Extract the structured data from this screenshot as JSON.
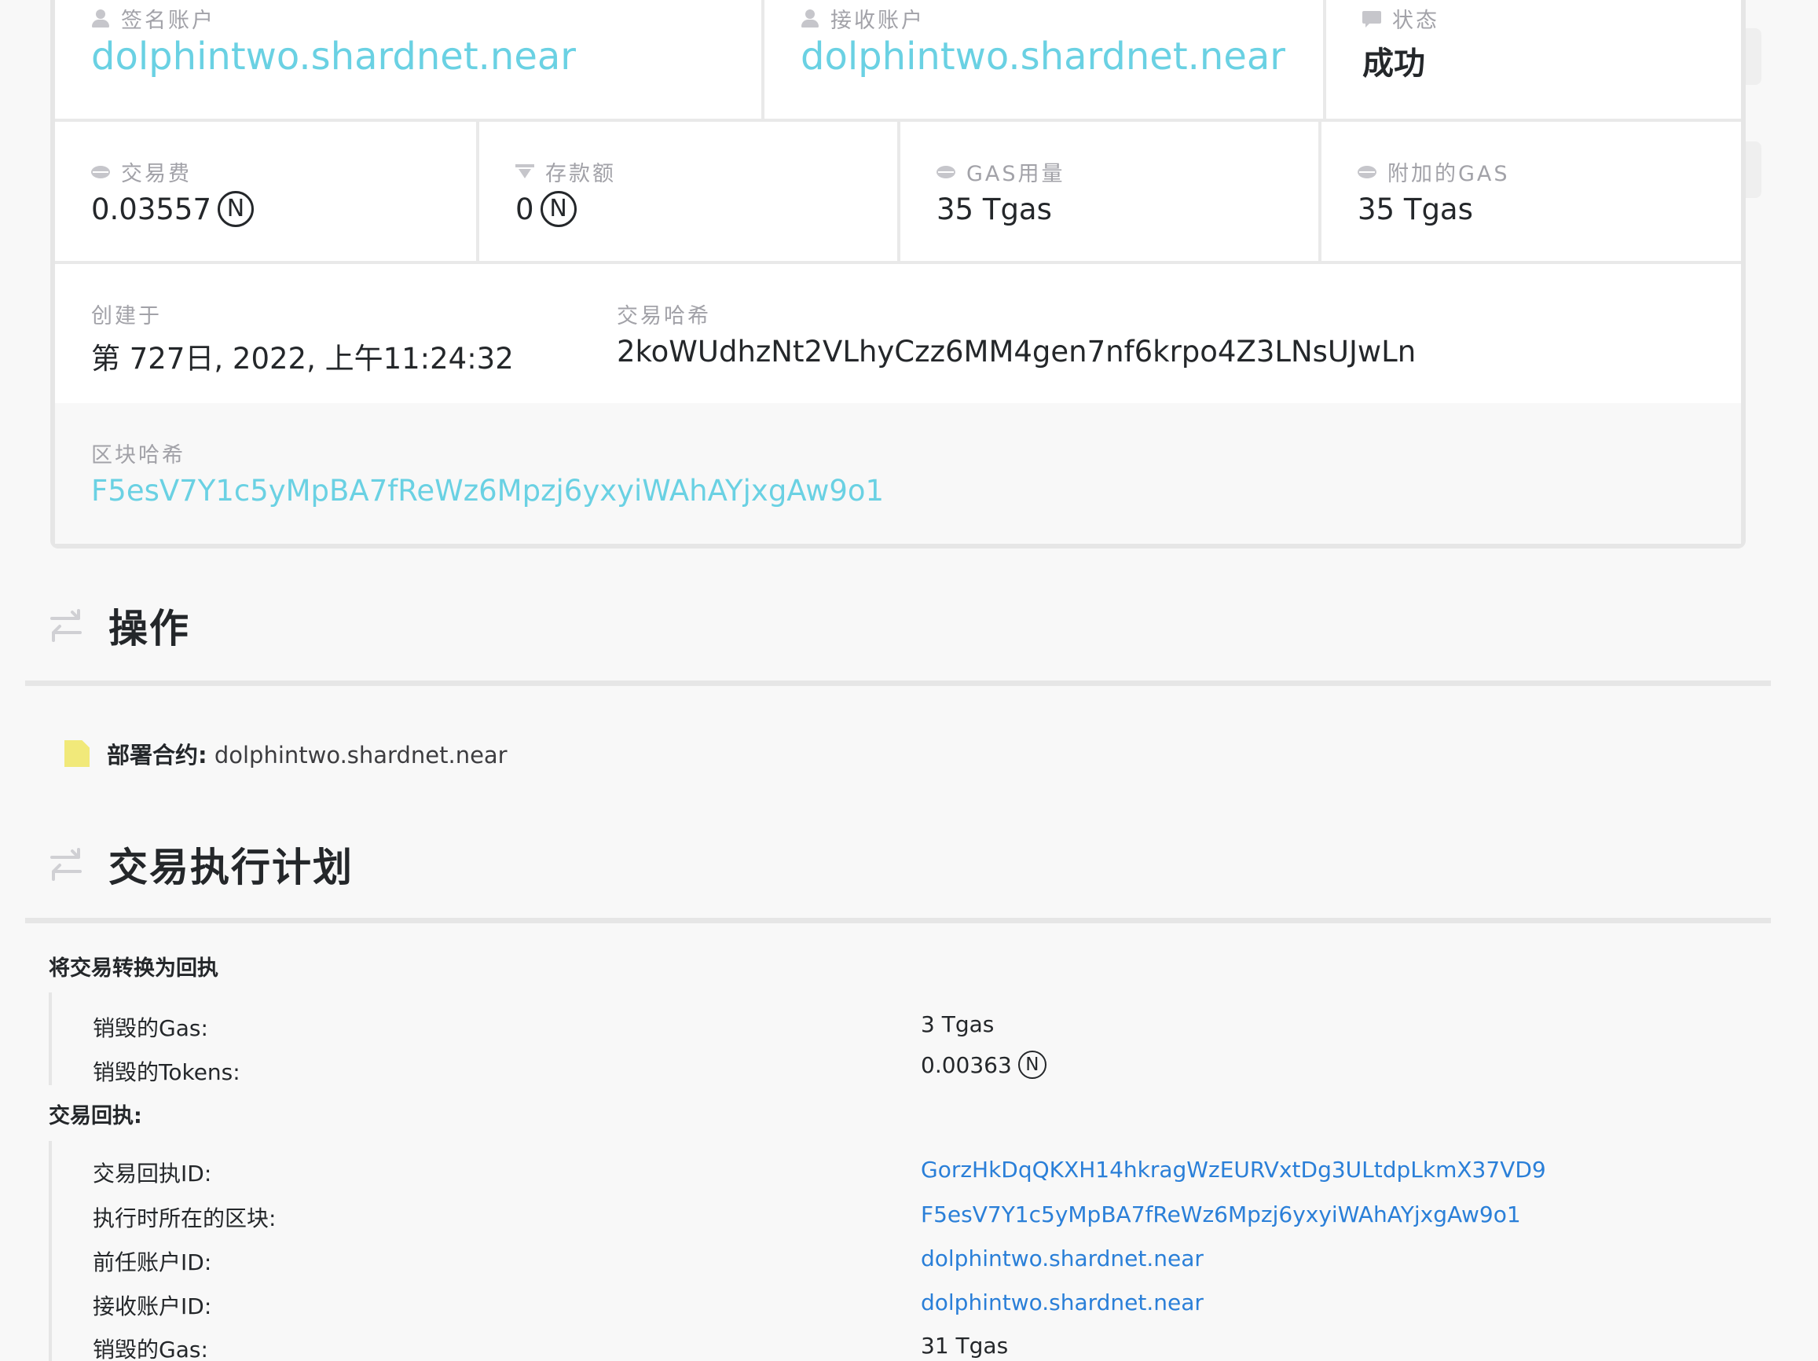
{
  "summary": {
    "signer": {
      "label": "签名账户",
      "value": "dolphintwo.shardnet.near"
    },
    "receiver": {
      "label": "接收账户",
      "value": "dolphintwo.shardnet.near"
    },
    "status": {
      "label": "状态",
      "value": "成功"
    },
    "fee": {
      "label": "交易费",
      "value": "0.03557",
      "unit": "N"
    },
    "deposit": {
      "label": "存款额",
      "value": "0",
      "unit": "N"
    },
    "gas_used": {
      "label": "GAS用量",
      "value": "35 Tgas"
    },
    "attached_gas": {
      "label": "附加的GAS",
      "value": "35 Tgas"
    },
    "created": {
      "label": "创建于",
      "value": "第 727日, 2022, 上午11:24:32"
    },
    "tx_hash": {
      "label": "交易哈希",
      "value": "2koWUdhzNt2VLhyCzz6MM4gen7nf6krpo4Z3LNsUJwLn"
    },
    "block_hash": {
      "label": "区块哈希",
      "value": "F5esV7Y1c5yMpBA7fReWz6Mpzj6yxyiWAhAYjxgAw9o1"
    }
  },
  "actions": {
    "title": "操作",
    "item": {
      "key": "部署合约:",
      "value": "dolphintwo.shardnet.near"
    }
  },
  "plan": {
    "title": "交易执行计划",
    "conversion": {
      "title": "将交易转换为回执",
      "rows": [
        {
          "key": "销毁的Gas:",
          "value": "3 Tgas"
        },
        {
          "key": "销毁的Tokens:",
          "value": "0.00363",
          "unit": "N"
        }
      ]
    },
    "receipt": {
      "title": "交易回执:",
      "rows": [
        {
          "key": "交易回执ID:",
          "value": "GorzHkDqQKXH14hkragWzEURVxtDg3ULtdpLkmX37VD9"
        },
        {
          "key": "执行时所在的区块:",
          "value": "F5esV7Y1c5yMpBA7fReWz6Mpzj6yxyiWAhAYjxgAw9o1"
        },
        {
          "key": "前任账户ID:",
          "value": "dolphintwo.shardnet.near"
        },
        {
          "key": "接收账户ID:",
          "value": "dolphintwo.shardnet.near"
        },
        {
          "key": "销毁的Gas:",
          "value": "31 Tgas"
        }
      ]
    }
  },
  "colors": {
    "link": "#6ad1e3",
    "blue_link": "#2a7fd8",
    "doc_icon": "#f1e97a"
  }
}
